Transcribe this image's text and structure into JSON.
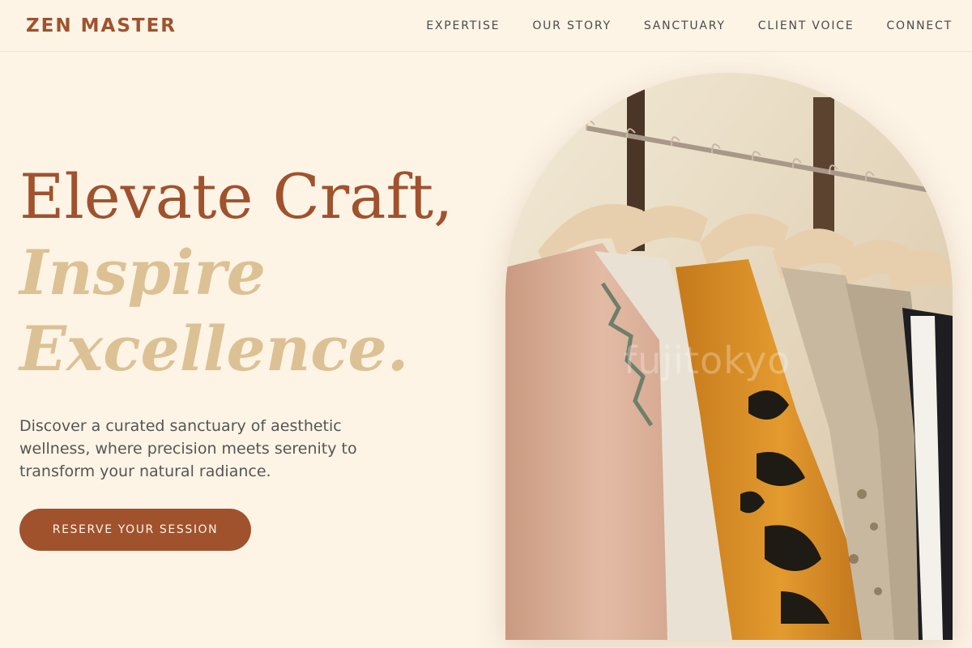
{
  "header": {
    "logo": "ZEN MASTER",
    "nav": [
      "EXPERTISE",
      "OUR STORY",
      "SANCTUARY",
      "CLIENT VOICE",
      "CONNECT"
    ]
  },
  "hero": {
    "title_line1": "Elevate Craft,",
    "title_line2": "Inspire",
    "title_line3": "Excellence.",
    "description": "Discover a curated sanctuary of aesthetic wellness, where precision meets serenity to transform your natural radiance.",
    "cta_label": "RESERVE YOUR SESSION"
  },
  "image": {
    "subject": "clothing-rack-photo",
    "watermark": "fujitokyo"
  },
  "colors": {
    "background": "#fdf4e6",
    "accent": "#a0522d",
    "accent_light": "#dcc194",
    "text": "#4a4a4a"
  }
}
